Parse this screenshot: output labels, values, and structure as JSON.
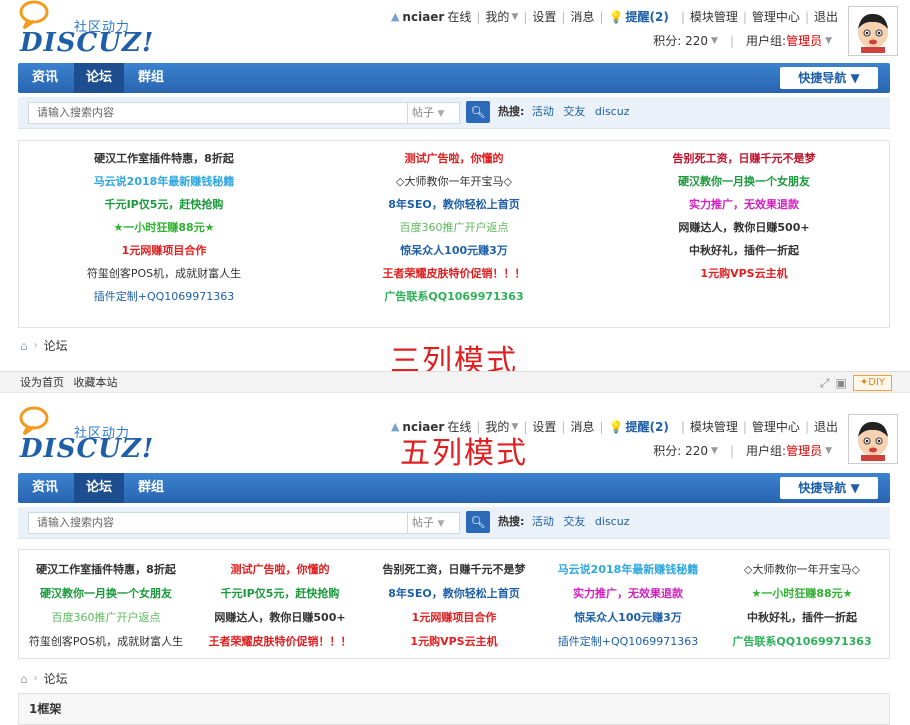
{
  "header": {
    "logo_tag": "社区动力",
    "logo_word": "DISCUZ!",
    "username": "nciaer",
    "online": "在线",
    "my": "我的",
    "settings": "设置",
    "messages": "消息",
    "remind": "提醒(2)",
    "module_manage": "模块管理",
    "admin_center": "管理中心",
    "logout": "退出",
    "points": "积分: 220",
    "usergroup_label": "用户组: ",
    "usergroup": "管理员"
  },
  "nav": {
    "items": [
      "资讯",
      "论坛",
      "群组"
    ],
    "active": "论坛",
    "quick_nav": "快捷导航 ▼"
  },
  "search": {
    "placeholder": "请输入搜索内容",
    "type": "帖子",
    "hot_label": "热搜:",
    "hot_keywords": [
      "活动",
      "交友",
      "discuz"
    ]
  },
  "breadcrumb": {
    "current": "论坛"
  },
  "labels": {
    "three_col": "三列模式",
    "five_col": "五列模式"
  },
  "ads_three": [
    {
      "text": "硬汉工作室插件特惠，8折起",
      "color": "#333333",
      "bold": true
    },
    {
      "text": "测试广告啦，你懂的",
      "color": "#e02020",
      "bold": true
    },
    {
      "text": "告别死工资，日赚千元不是梦",
      "color": "#c0102a",
      "bold": true
    },
    {
      "text": "马云说2018年最新赚钱秘籍",
      "color": "#2ea7e0",
      "bold": true
    },
    {
      "text": "◇大师教你一年开宝马◇",
      "color": "#333333",
      "bold": false
    },
    {
      "text": "硬汉教你一月换一个女朋友",
      "color": "#1a9a3a",
      "bold": true
    },
    {
      "text": "千元IP仅5元，赶快抢购",
      "color": "#1a9a3a",
      "bold": true
    },
    {
      "text": "8年SEO，教你轻松上首页",
      "color": "#1f5fa8",
      "bold": true
    },
    {
      "text": "实力推广，无效果退款",
      "color": "#d020c0",
      "bold": true
    },
    {
      "text": "★一小时狂赚88元★",
      "color": "#2fb32f",
      "bold": true
    },
    {
      "text": "百度360推广开户返点",
      "color": "#5cb85c",
      "bold": false
    },
    {
      "text": "网赚达人，教你日赚500+",
      "color": "#333333",
      "bold": true
    },
    {
      "text": "1元网赚项目合作",
      "color": "#e02020",
      "bold": true
    },
    {
      "text": "惊呆众人100元赚3万",
      "color": "#1f5fa8",
      "bold": true
    },
    {
      "text": "中秋好礼，插件一折起",
      "color": "#333333",
      "bold": true
    },
    {
      "text": "符玺创客POS机，成就财富人生",
      "color": "#333333",
      "bold": false
    },
    {
      "text": "王者荣耀皮肤特价促销！！！",
      "color": "#e02020",
      "bold": true
    },
    {
      "text": "1元购VPS云主机",
      "color": "#e02020",
      "bold": true
    },
    {
      "text": "插件定制+QQ1069971363",
      "color": "#1f5fa8",
      "bold": false
    },
    {
      "text": "广告联系QQ1069971363",
      "color": "#2eb05a",
      "bold": true
    }
  ],
  "ads_five": [
    {
      "text": "硬汉工作室插件特惠，8折起",
      "color": "#333333",
      "bold": true
    },
    {
      "text": "测试广告啦，你懂的",
      "color": "#e02020",
      "bold": true
    },
    {
      "text": "告别死工资，日赚千元不是梦",
      "color": "#333333",
      "bold": true
    },
    {
      "text": "马云说2018年最新赚钱秘籍",
      "color": "#2ea7e0",
      "bold": true
    },
    {
      "text": "◇大师教你一年开宝马◇",
      "color": "#333333",
      "bold": false
    },
    {
      "text": "硬汉教你一月换一个女朋友",
      "color": "#1a9a3a",
      "bold": true
    },
    {
      "text": "千元IP仅5元，赶快抢购",
      "color": "#1a9a3a",
      "bold": true
    },
    {
      "text": "8年SEO，教你轻松上首页",
      "color": "#1f5fa8",
      "bold": true
    },
    {
      "text": "实力推广，无效果退款",
      "color": "#d020c0",
      "bold": true
    },
    {
      "text": "★一小时狂赚88元★",
      "color": "#2fb32f",
      "bold": true
    },
    {
      "text": "百度360推广开户返点",
      "color": "#5cb85c",
      "bold": false
    },
    {
      "text": "网赚达人，教你日赚500+",
      "color": "#333333",
      "bold": true
    },
    {
      "text": "1元网赚项目合作",
      "color": "#e02020",
      "bold": true
    },
    {
      "text": "惊呆众人100元赚3万",
      "color": "#1f5fa8",
      "bold": true
    },
    {
      "text": "中秋好礼，插件一折起",
      "color": "#333333",
      "bold": true
    },
    {
      "text": "符玺创客POS机，成就财富人生",
      "color": "#333333",
      "bold": false
    },
    {
      "text": "王者荣耀皮肤特价促销！！！",
      "color": "#e02020",
      "bold": true
    },
    {
      "text": "1元购VPS云主机",
      "color": "#e02020",
      "bold": true
    },
    {
      "text": "插件定制+QQ1069971363",
      "color": "#1f5fa8",
      "bold": false
    },
    {
      "text": "广告联系QQ1069971363",
      "color": "#2eb05a",
      "bold": true
    }
  ],
  "footer_bar": {
    "set_home": "设为首页",
    "bookmark": "收藏本站",
    "diy": "✦DIY"
  },
  "frame": {
    "title": "1框架"
  },
  "icons": {
    "user": "user-icon",
    "bulb": "bulb-icon",
    "search": "search-icon",
    "home": "home-icon"
  }
}
